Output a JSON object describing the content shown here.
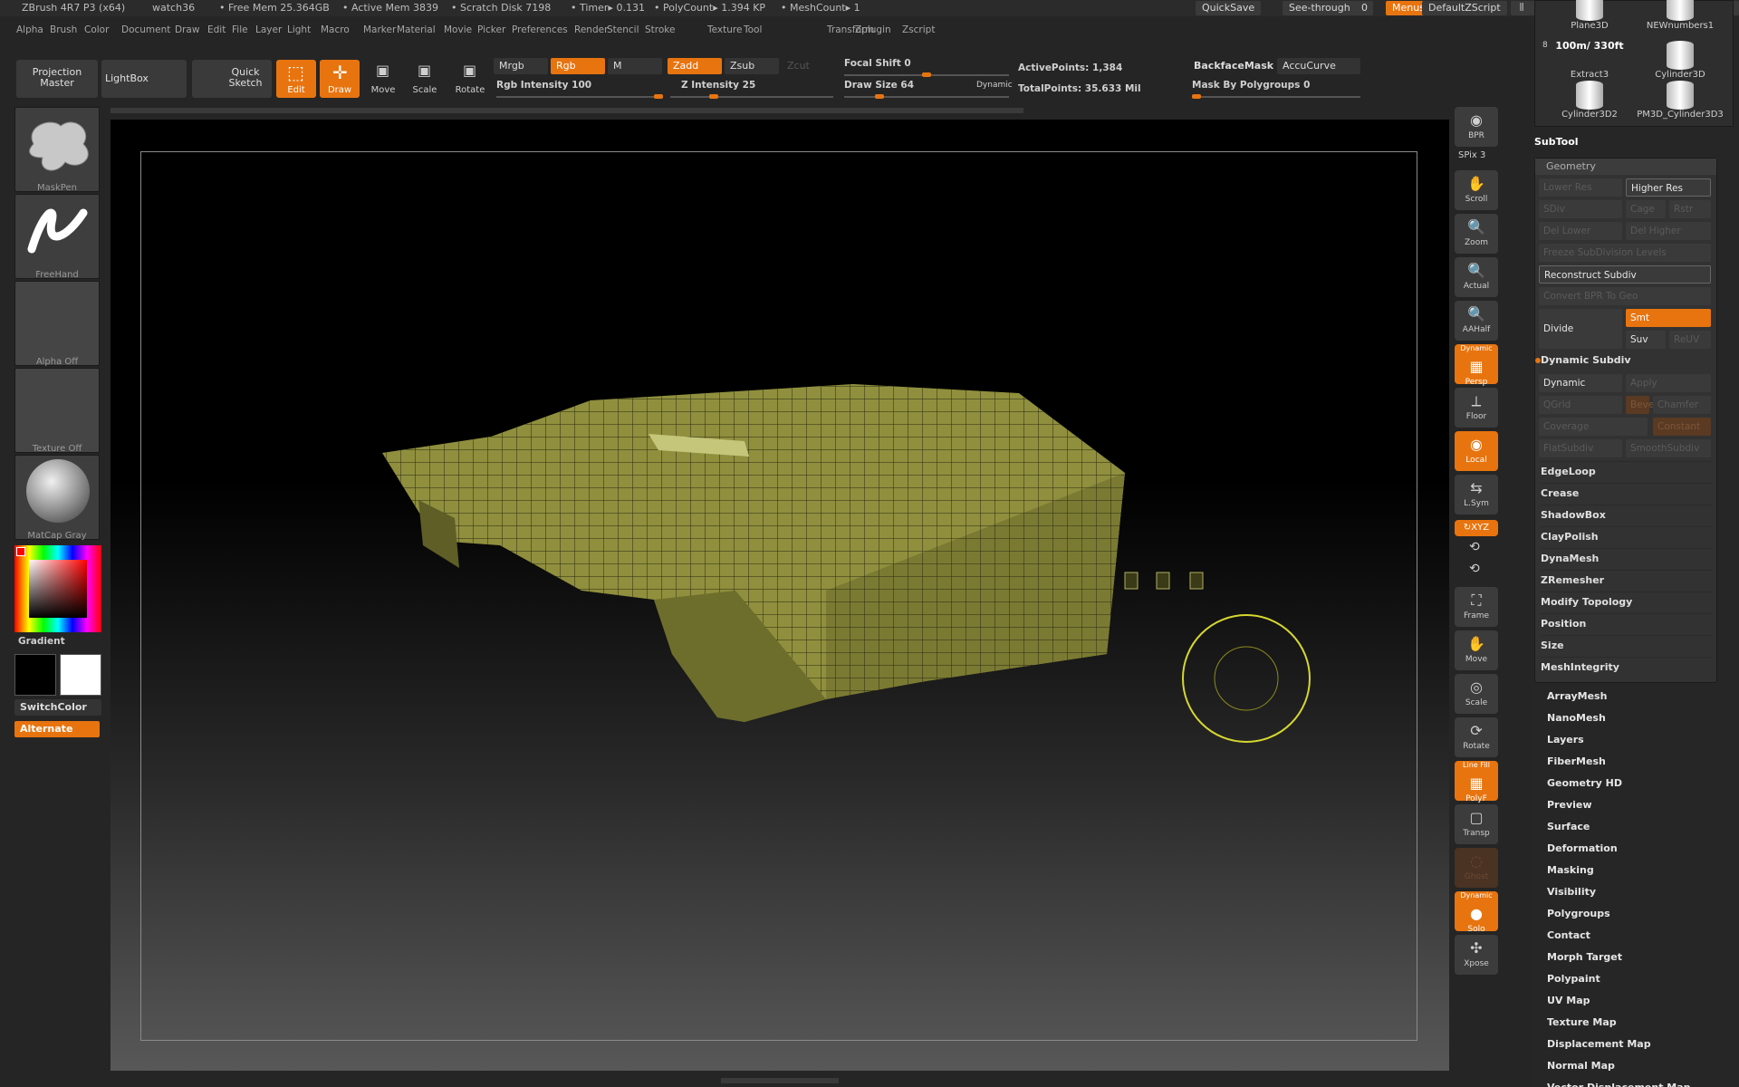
{
  "title_bar": {
    "app": "ZBrush 4R7 P3 (x64)",
    "document": "watch36",
    "free_mem": "• Free Mem 25.364GB",
    "active_mem": "• Active Mem 3839",
    "scratch": "• Scratch Disk 7198",
    "timer": "• Timer▸ 0.131",
    "polycount": "• PolyCount▸ 1.394 KP",
    "meshcount": "• MeshCount▸ 1",
    "quicksave": "QuickSave",
    "see_through": "See-through",
    "see_through_value": "0",
    "menus": "Menus",
    "default_zscript": "DefaultZScript"
  },
  "menus": [
    "Alpha",
    "Brush",
    "Color",
    "Document",
    "Draw",
    "Edit",
    "File",
    "Layer",
    "Light",
    "Macro",
    "Marker",
    "Material",
    "Movie",
    "Picker",
    "Preferences",
    "Render",
    "Stencil",
    "Stroke",
    "Texture",
    "Tool",
    "Transform",
    "Zplugin",
    "Zscript"
  ],
  "toolbar": {
    "projection_master": "Projection Master",
    "lightbox": "LightBox",
    "quick_sketch": "Quick Sketch",
    "edit": "Edit",
    "draw": "Draw",
    "move": "Move",
    "scale": "Scale",
    "rotate": "Rotate",
    "mrgb": "Mrgb",
    "rgb": "Rgb",
    "m": "M",
    "rgb_intensity": "Rgb Intensity 100",
    "rgb_intensity_value": 100,
    "zadd": "Zadd",
    "zsub": "Zsub",
    "zcut": "Zcut",
    "z_intensity": "Z Intensity 25",
    "z_intensity_value": 25,
    "focal_shift": "Focal Shift 0",
    "focal_shift_value": 0,
    "draw_size": "Draw Size 64",
    "draw_size_value": 64,
    "dynamic": "Dynamic",
    "active_points": "ActivePoints: 1,384",
    "total_points": "TotalPoints: 35.633 Mil",
    "backface_mask": "BackfaceMask",
    "accucurve": "AccuCurve",
    "mask_by_polygroups": "Mask By Polygroups 0",
    "mask_by_polygroups_value": 0
  },
  "left_shelf": {
    "brush": "MaskPen",
    "stroke": "FreeHand",
    "alpha": "Alpha Off",
    "texture": "Texture Off",
    "material": "MatCap Gray",
    "gradient": "Gradient",
    "switch_color": "SwitchColor",
    "alternate": "Alternate"
  },
  "right_shelf": {
    "bpr": "BPR",
    "spix": "SPix 3",
    "spix_value": 3,
    "scroll": "Scroll",
    "zoom": "Zoom",
    "actual": "Actual",
    "aahalf": "AAHalf",
    "persp_top": "Dynamic",
    "persp": "Persp",
    "floor": "Floor",
    "local": "Local",
    "lsym": "L.Sym",
    "xyz": "↻XYZ",
    "frame": "Frame",
    "move": "Move",
    "scale": "Scale",
    "rotate": "Rotate",
    "polyf_top": "Line Fill",
    "polyf": "PolyF",
    "transp": "Transp",
    "ghost": "Ghost",
    "solo_top": "Dynamic",
    "solo": "Solo",
    "xpose": "Xpose"
  },
  "subtools": {
    "row_number": "8",
    "items": [
      "Plane3D",
      "NEWnumbers1",
      "Extract3",
      "Cylinder3D",
      "Cylinder3D2",
      "PM3D_Cylinder3D3"
    ],
    "extract_label": "100m/ 330ft"
  },
  "panel": {
    "subtool": "SubTool",
    "geometry": "Geometry",
    "lower_res": "Lower Res",
    "higher_res": "Higher Res",
    "sdiv": "SDiv",
    "cage": "Cage",
    "rstr": "Rstr",
    "del_lower": "Del Lower",
    "del_higher": "Del Higher",
    "freeze": "Freeze SubDivision Levels",
    "reconstruct": "Reconstruct Subdiv",
    "convert_bpr": "Convert BPR To Geo",
    "divide": "Divide",
    "smt": "Smt",
    "suv": "Suv",
    "reuv": "ReUV",
    "dynamic_subdiv": "Dynamic Subdiv",
    "dynamic": "Dynamic",
    "apply": "Apply",
    "qgrid": "QGrid",
    "bevel": "Bevel",
    "chamfer": "Chamfer",
    "coverage": "Coverage",
    "constant": "Constant",
    "flatsubdiv": "FlatSubdiv",
    "smoothsubdiv": "SmoothSubdiv",
    "geo_items": [
      "EdgeLoop",
      "Crease",
      "ShadowBox",
      "ClayPolish",
      "DynaMesh",
      "ZRemesher",
      "Modify Topology",
      "Position",
      "Size",
      "MeshIntegrity"
    ],
    "palettes": [
      "ArrayMesh",
      "NanoMesh",
      "Layers",
      "FiberMesh",
      "Geometry HD",
      "Preview",
      "Surface",
      "Deformation",
      "Masking",
      "Visibility",
      "Polygroups",
      "Contact",
      "Morph Target",
      "Polypaint",
      "UV Map",
      "Texture Map",
      "Displacement Map",
      "Normal Map",
      "Vector Displacement Map"
    ]
  },
  "colors": {
    "accent": "#e8740f",
    "mesh": "#8a8a3a",
    "cursor": "#d6d630"
  }
}
